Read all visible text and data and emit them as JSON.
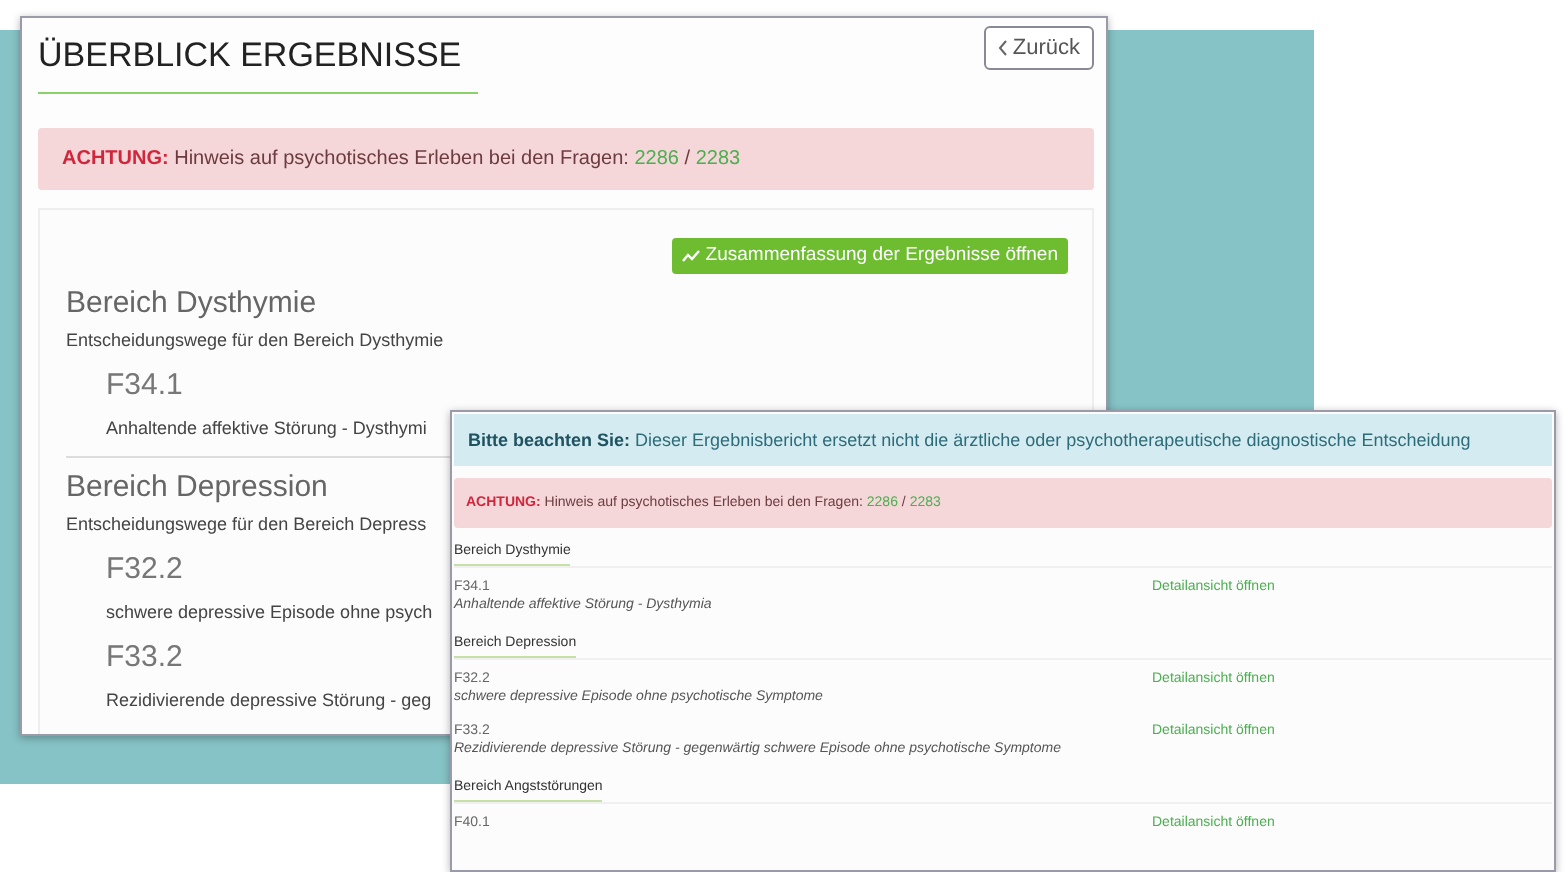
{
  "back_window": {
    "title": "ÜBERBLICK ERGEBNISSE",
    "back_button": "Zurück",
    "alert": {
      "label": "ACHTUNG:",
      "text": "Hinweis auf psychotisches Erleben bei den Fragen:",
      "refs": [
        "2286",
        "2283"
      ],
      "separator": "/"
    },
    "summary_button": "Zusammenfassung der Ergebnisse öffnen",
    "sections": [
      {
        "title": "Bereich Dysthymie",
        "subtitle": "Entscheidungswege für den Bereich Dysthymie",
        "diagnoses": [
          {
            "code": "F34.1",
            "description": "Anhaltende affektive Störung - Dysthymi"
          }
        ]
      },
      {
        "title": "Bereich Depression",
        "subtitle": "Entscheidungswege für den Bereich Depress",
        "diagnoses": [
          {
            "code": "F32.2",
            "description": "schwere depressive Episode ohne psych"
          },
          {
            "code": "F33.2",
            "description": "Rezidivierende depressive Störung - geg"
          }
        ]
      }
    ]
  },
  "front_window": {
    "notice": {
      "label": "Bitte beachten Sie:",
      "text": "Dieser Ergebnisbericht ersetzt nicht die ärztliche oder psychotherapeutische diagnostische Entscheidung"
    },
    "alert": {
      "label": "ACHTUNG:",
      "text": "Hinweis auf psychotisches Erleben bei den Fragen:",
      "refs": [
        "2286",
        "2283"
      ],
      "separator": "/"
    },
    "sections": [
      {
        "title": "Bereich Dysthymie",
        "diagnoses": [
          {
            "code": "F34.1",
            "description": "Anhaltende affektive Störung - Dysthymia",
            "link": "Detailansicht öffnen"
          }
        ]
      },
      {
        "title": "Bereich Depression",
        "diagnoses": [
          {
            "code": "F32.2",
            "description": "schwere depressive Episode ohne psychotische Symptome",
            "link": "Detailansicht öffnen"
          },
          {
            "code": "F33.2",
            "description": "Rezidivierende depressive Störung - gegenwärtig schwere Episode ohne psychotische Symptome",
            "link": "Detailansicht öffnen"
          }
        ]
      },
      {
        "title": "Bereich Angststörungen",
        "diagnoses": [
          {
            "code": "F40.1",
            "link": "Detailansicht öffnen"
          }
        ]
      }
    ]
  }
}
